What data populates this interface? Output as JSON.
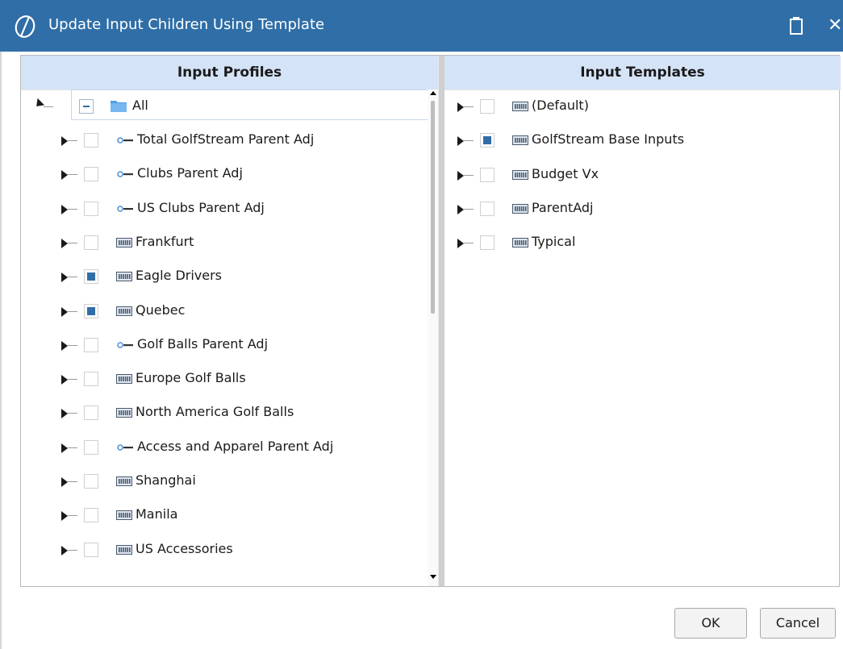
{
  "window": {
    "title": "Update Input Children Using Template",
    "logo_icon": "stylized-o-logo-icon",
    "accent_color": "#2f6ea7"
  },
  "left_pane": {
    "header": "Input Profiles",
    "root": {
      "label": "All",
      "state": "partial",
      "icon": "folder-icon",
      "expanded": true
    },
    "items": [
      {
        "label": "Total GolfStream Parent Adj",
        "checked": false,
        "icon": "parent-adj-icon"
      },
      {
        "label": "Clubs Parent Adj",
        "checked": false,
        "icon": "parent-adj-icon"
      },
      {
        "label": "US Clubs Parent Adj",
        "checked": false,
        "icon": "parent-adj-icon"
      },
      {
        "label": "Frankfurt",
        "checked": false,
        "icon": "grid-profile-icon"
      },
      {
        "label": "Eagle Drivers",
        "checked": true,
        "icon": "grid-profile-icon"
      },
      {
        "label": "Quebec",
        "checked": true,
        "icon": "grid-profile-icon"
      },
      {
        "label": "Golf Balls Parent Adj",
        "checked": false,
        "icon": "parent-adj-icon"
      },
      {
        "label": "Europe Golf Balls",
        "checked": false,
        "icon": "grid-profile-icon"
      },
      {
        "label": "North America Golf Balls",
        "checked": false,
        "icon": "grid-profile-icon"
      },
      {
        "label": "Access and Apparel Parent Adj",
        "checked": false,
        "icon": "parent-adj-icon"
      },
      {
        "label": "Shanghai",
        "checked": false,
        "icon": "grid-profile-icon"
      },
      {
        "label": "Manila",
        "checked": false,
        "icon": "grid-profile-icon"
      },
      {
        "label": "US Accessories",
        "checked": false,
        "icon": "grid-profile-icon"
      }
    ]
  },
  "right_pane": {
    "header": "Input Templates",
    "items": [
      {
        "label": "(Default)",
        "checked": false,
        "icon": "grid-profile-icon"
      },
      {
        "label": "GolfStream Base Inputs",
        "checked": true,
        "icon": "grid-profile-icon"
      },
      {
        "label": "Budget Vx",
        "checked": false,
        "icon": "grid-profile-icon"
      },
      {
        "label": "ParentAdj",
        "checked": false,
        "icon": "grid-profile-icon"
      },
      {
        "label": "Typical",
        "checked": false,
        "icon": "grid-profile-icon"
      }
    ]
  },
  "buttons": {
    "ok": "OK",
    "cancel": "Cancel"
  }
}
